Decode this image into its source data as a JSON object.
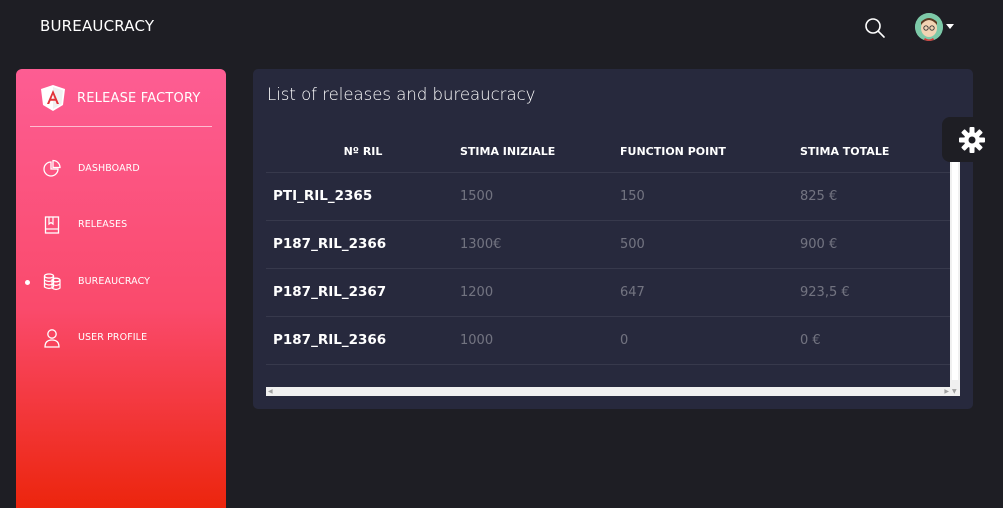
{
  "app": {
    "title": "BUREAUCRACY"
  },
  "sidebar": {
    "logo_text": "RELEASE FACTORY",
    "items": [
      {
        "label": "DASHBOARD",
        "icon": "pie-chart-icon",
        "active": false
      },
      {
        "label": "RELEASES",
        "icon": "book-icon",
        "active": false
      },
      {
        "label": "BUREAUCRACY",
        "icon": "coins-icon",
        "active": true
      },
      {
        "label": "USER PROFILE",
        "icon": "user-icon",
        "active": false
      }
    ]
  },
  "card": {
    "title": "List of releases and bureaucracy",
    "table": {
      "headers": [
        "Nº RIL",
        "STIMA INIZIALE",
        "FUNCTION POINT",
        "STIMA TOTALE"
      ],
      "rows": [
        [
          "PTI_RIL_2365",
          "1500",
          "150",
          "825 €"
        ],
        [
          "P187_RIL_2366",
          "1300€",
          "500",
          "900 €"
        ],
        [
          "P187_RIL_2367",
          "1200",
          "647",
          "923,5 €"
        ],
        [
          "P187_RIL_2366",
          "1000",
          "0",
          "0 €"
        ]
      ]
    }
  },
  "colors": {
    "sidebar_top": "#fd5d93",
    "sidebar_bottom": "#ec250d",
    "card_bg": "#27293d",
    "page_bg": "#1e1e24"
  }
}
